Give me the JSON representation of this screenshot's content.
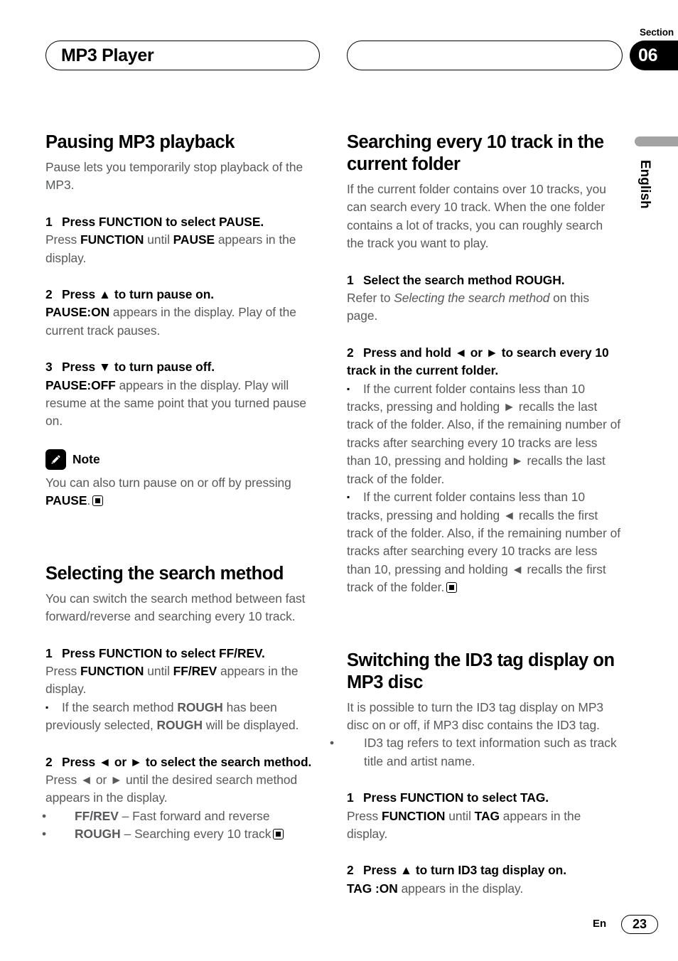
{
  "header": {
    "title": "MP3 Player",
    "section_word": "Section",
    "section_number": "06",
    "language_tab": "English"
  },
  "footer": {
    "lang_code": "En",
    "page_number": "23"
  },
  "left_column": {
    "section1": {
      "heading": "Pausing MP3 playback",
      "intro": "Pause lets you temporarily stop playback of the MP3.",
      "steps": [
        {
          "num": "1",
          "title_plain_1": "Press FUNCTION to select PAUSE.",
          "body_1": "Press ",
          "body_b1": "FUNCTION",
          "body_2": " until ",
          "body_b2": "PAUSE",
          "body_3": " appears in the display."
        },
        {
          "num": "2",
          "title_plain_1": "Press ▲ to turn pause on.",
          "body_b1": "PAUSE:ON",
          "body_1": " appears in the display. Play of the current track pauses."
        },
        {
          "num": "3",
          "title_plain_1": "Press ▼ to turn pause off.",
          "body_b1": "PAUSE:OFF",
          "body_1": " appears in the display. Play will resume at the same point that you turned pause on."
        }
      ],
      "note": {
        "label": "Note",
        "icon": "pencil-note-icon",
        "text_1": "You can also turn pause on or off by pressing ",
        "text_b": "PAUSE",
        "text_2": "."
      }
    },
    "section2": {
      "heading": "Selecting the search method",
      "intro": "You can switch the search method between fast forward/reverse and searching every 10 track.",
      "step1": {
        "num": "1",
        "title": "Press FUNCTION to select FF/REV.",
        "body_1": "Press ",
        "body_b1": "FUNCTION",
        "body_2": " until ",
        "body_b2": "FF/REV",
        "body_3": " appears in the display."
      },
      "bullet1": {
        "marker": "▪",
        "text_1": "If the search method ",
        "text_b1": "ROUGH",
        "text_2": " has been previously selected, ",
        "text_b2": "ROUGH",
        "text_3": " will be displayed."
      },
      "step2": {
        "num": "2",
        "title": "Press ◄ or ► to select the search method.",
        "body_1": "Press ◄ or ► until the desired search method appears in the display."
      },
      "options": [
        {
          "marker": "•",
          "term": "FF/REV",
          "desc": " – Fast forward and reverse"
        },
        {
          "marker": "•",
          "term": "ROUGH",
          "desc": " – Searching every 10 track"
        }
      ]
    }
  },
  "right_column": {
    "section1": {
      "heading": "Searching every 10 track in the current folder",
      "intro": "If the current folder contains over 10 tracks, you can search every 10 track. When the one folder contains a lot of tracks, you can roughly search the track you want to play.",
      "step1": {
        "num": "1",
        "title": "Select the search method ROUGH.",
        "body_1": "Refer to ",
        "body_italic": "Selecting the search method",
        "body_2": " on this page."
      },
      "step2": {
        "num": "2",
        "title": "Press and hold ◄ or ► to search every 10 track in the current folder."
      },
      "bullets": [
        {
          "marker": "▪",
          "text": "If the current folder contains less than 10 tracks, pressing and holding ► recalls the last track of the folder. Also, if the remaining number of tracks after searching every 10 tracks are less than 10, pressing and holding ► recalls the last track of the folder."
        },
        {
          "marker": "▪",
          "text": "If the current folder contains less than 10 tracks, pressing and holding ◄ recalls the first track of the folder. Also, if the remaining number of tracks after searching every 10 tracks are less than 10, pressing and holding ◄ recalls the first track of the folder."
        }
      ]
    },
    "section2": {
      "heading": "Switching the ID3 tag display on MP3 disc",
      "intro": "It is possible to turn the ID3 tag display on MP3 disc on or off, if MP3 disc contains the ID3 tag.",
      "dot_bullet": {
        "marker": "•",
        "text": "ID3 tag refers to text information such as track title and artist name."
      },
      "step1": {
        "num": "1",
        "title": "Press FUNCTION to select TAG.",
        "body_1": "Press ",
        "body_b1": "FUNCTION",
        "body_2": " until ",
        "body_b2": "TAG",
        "body_3": " appears in the display."
      },
      "step2": {
        "num": "2",
        "title": "Press ▲ to turn ID3 tag display on.",
        "body_b1": "TAG :ON",
        "body_1": " appears in the display."
      }
    }
  }
}
